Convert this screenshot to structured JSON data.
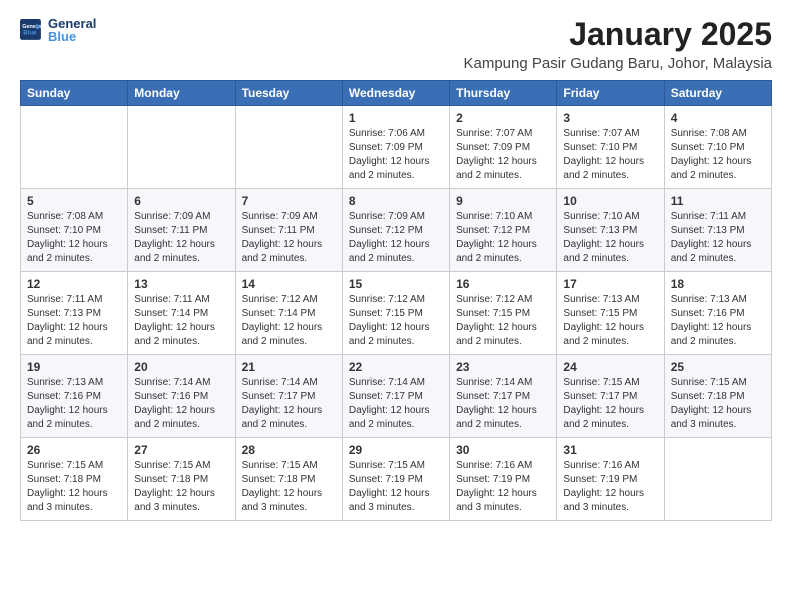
{
  "header": {
    "logo_line1": "General",
    "logo_line2": "Blue",
    "month": "January 2025",
    "location": "Kampung Pasir Gudang Baru, Johor, Malaysia"
  },
  "weekdays": [
    "Sunday",
    "Monday",
    "Tuesday",
    "Wednesday",
    "Thursday",
    "Friday",
    "Saturday"
  ],
  "weeks": [
    [
      {
        "day": "",
        "info": ""
      },
      {
        "day": "",
        "info": ""
      },
      {
        "day": "",
        "info": ""
      },
      {
        "day": "1",
        "info": "Sunrise: 7:06 AM\nSunset: 7:09 PM\nDaylight: 12 hours and 2 minutes."
      },
      {
        "day": "2",
        "info": "Sunrise: 7:07 AM\nSunset: 7:09 PM\nDaylight: 12 hours and 2 minutes."
      },
      {
        "day": "3",
        "info": "Sunrise: 7:07 AM\nSunset: 7:10 PM\nDaylight: 12 hours and 2 minutes."
      },
      {
        "day": "4",
        "info": "Sunrise: 7:08 AM\nSunset: 7:10 PM\nDaylight: 12 hours and 2 minutes."
      }
    ],
    [
      {
        "day": "5",
        "info": "Sunrise: 7:08 AM\nSunset: 7:10 PM\nDaylight: 12 hours and 2 minutes."
      },
      {
        "day": "6",
        "info": "Sunrise: 7:09 AM\nSunset: 7:11 PM\nDaylight: 12 hours and 2 minutes."
      },
      {
        "day": "7",
        "info": "Sunrise: 7:09 AM\nSunset: 7:11 PM\nDaylight: 12 hours and 2 minutes."
      },
      {
        "day": "8",
        "info": "Sunrise: 7:09 AM\nSunset: 7:12 PM\nDaylight: 12 hours and 2 minutes."
      },
      {
        "day": "9",
        "info": "Sunrise: 7:10 AM\nSunset: 7:12 PM\nDaylight: 12 hours and 2 minutes."
      },
      {
        "day": "10",
        "info": "Sunrise: 7:10 AM\nSunset: 7:13 PM\nDaylight: 12 hours and 2 minutes."
      },
      {
        "day": "11",
        "info": "Sunrise: 7:11 AM\nSunset: 7:13 PM\nDaylight: 12 hours and 2 minutes."
      }
    ],
    [
      {
        "day": "12",
        "info": "Sunrise: 7:11 AM\nSunset: 7:13 PM\nDaylight: 12 hours and 2 minutes."
      },
      {
        "day": "13",
        "info": "Sunrise: 7:11 AM\nSunset: 7:14 PM\nDaylight: 12 hours and 2 minutes."
      },
      {
        "day": "14",
        "info": "Sunrise: 7:12 AM\nSunset: 7:14 PM\nDaylight: 12 hours and 2 minutes."
      },
      {
        "day": "15",
        "info": "Sunrise: 7:12 AM\nSunset: 7:15 PM\nDaylight: 12 hours and 2 minutes."
      },
      {
        "day": "16",
        "info": "Sunrise: 7:12 AM\nSunset: 7:15 PM\nDaylight: 12 hours and 2 minutes."
      },
      {
        "day": "17",
        "info": "Sunrise: 7:13 AM\nSunset: 7:15 PM\nDaylight: 12 hours and 2 minutes."
      },
      {
        "day": "18",
        "info": "Sunrise: 7:13 AM\nSunset: 7:16 PM\nDaylight: 12 hours and 2 minutes."
      }
    ],
    [
      {
        "day": "19",
        "info": "Sunrise: 7:13 AM\nSunset: 7:16 PM\nDaylight: 12 hours and 2 minutes."
      },
      {
        "day": "20",
        "info": "Sunrise: 7:14 AM\nSunset: 7:16 PM\nDaylight: 12 hours and 2 minutes."
      },
      {
        "day": "21",
        "info": "Sunrise: 7:14 AM\nSunset: 7:17 PM\nDaylight: 12 hours and 2 minutes."
      },
      {
        "day": "22",
        "info": "Sunrise: 7:14 AM\nSunset: 7:17 PM\nDaylight: 12 hours and 2 minutes."
      },
      {
        "day": "23",
        "info": "Sunrise: 7:14 AM\nSunset: 7:17 PM\nDaylight: 12 hours and 2 minutes."
      },
      {
        "day": "24",
        "info": "Sunrise: 7:15 AM\nSunset: 7:17 PM\nDaylight: 12 hours and 2 minutes."
      },
      {
        "day": "25",
        "info": "Sunrise: 7:15 AM\nSunset: 7:18 PM\nDaylight: 12 hours and 3 minutes."
      }
    ],
    [
      {
        "day": "26",
        "info": "Sunrise: 7:15 AM\nSunset: 7:18 PM\nDaylight: 12 hours and 3 minutes."
      },
      {
        "day": "27",
        "info": "Sunrise: 7:15 AM\nSunset: 7:18 PM\nDaylight: 12 hours and 3 minutes."
      },
      {
        "day": "28",
        "info": "Sunrise: 7:15 AM\nSunset: 7:18 PM\nDaylight: 12 hours and 3 minutes."
      },
      {
        "day": "29",
        "info": "Sunrise: 7:15 AM\nSunset: 7:19 PM\nDaylight: 12 hours and 3 minutes."
      },
      {
        "day": "30",
        "info": "Sunrise: 7:16 AM\nSunset: 7:19 PM\nDaylight: 12 hours and 3 minutes."
      },
      {
        "day": "31",
        "info": "Sunrise: 7:16 AM\nSunset: 7:19 PM\nDaylight: 12 hours and 3 minutes."
      },
      {
        "day": "",
        "info": ""
      }
    ]
  ]
}
